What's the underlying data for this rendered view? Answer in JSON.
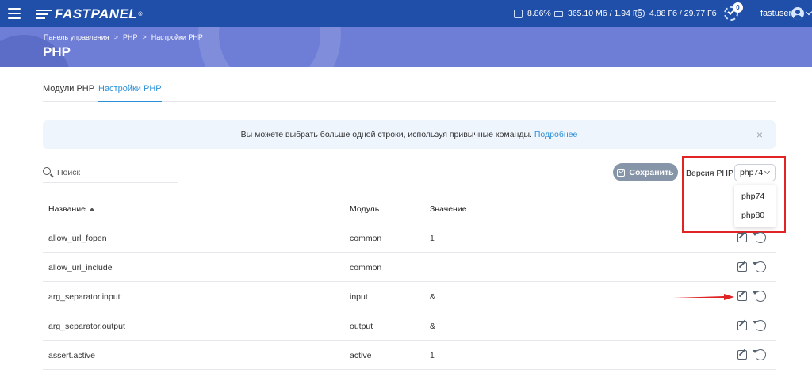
{
  "topbar": {
    "brand": "FASTPANEL",
    "brand_mark": "®",
    "cpu": "8.86%",
    "ram": "365.10 Мб / 1.94 Гб",
    "disk": "4.88 Гб / 29.77 Гб",
    "tasks_count": "0",
    "username": "fastuser"
  },
  "header": {
    "breadcrumbs": [
      "Панель управления",
      "PHP",
      "Настройки PHP"
    ],
    "breadcrumb_sep": ">",
    "title": "PHP"
  },
  "tabs": [
    {
      "label": "Модули PHP",
      "active": false
    },
    {
      "label": "Настройки PHP",
      "active": true
    }
  ],
  "notice": {
    "text": "Вы можете выбрать больше одной строки, используя привычные команды.",
    "link": "Подробнее",
    "close": "×"
  },
  "search": {
    "placeholder": "Поиск",
    "value": ""
  },
  "save_button": "Сохранить",
  "version": {
    "label": "Версия PHP",
    "selected": "php74",
    "options": [
      "php74",
      "php80"
    ]
  },
  "table": {
    "headers": [
      "Название",
      "Модуль",
      "Значение"
    ],
    "sorted_column": "Название",
    "rows": [
      {
        "name": "allow_url_fopen",
        "module": "common",
        "value": "1"
      },
      {
        "name": "allow_url_include",
        "module": "common",
        "value": ""
      },
      {
        "name": "arg_separator.input",
        "module": "input",
        "value": "&"
      },
      {
        "name": "arg_separator.output",
        "module": "output",
        "value": "&"
      },
      {
        "name": "assert.active",
        "module": "active",
        "value": "1"
      }
    ]
  },
  "colors": {
    "topbar": "#1f4fa8",
    "header_band": "#6e7ed6",
    "accent": "#2a8fd8",
    "highlight_frame": "#e02424",
    "annotation_arrow": "#e02424"
  },
  "icons": [
    "menu-icon",
    "cpu-icon",
    "ram-icon",
    "disk-icon",
    "tasks-icon",
    "avatar-icon",
    "search-icon",
    "save-icon",
    "edit-icon",
    "reset-icon"
  ]
}
